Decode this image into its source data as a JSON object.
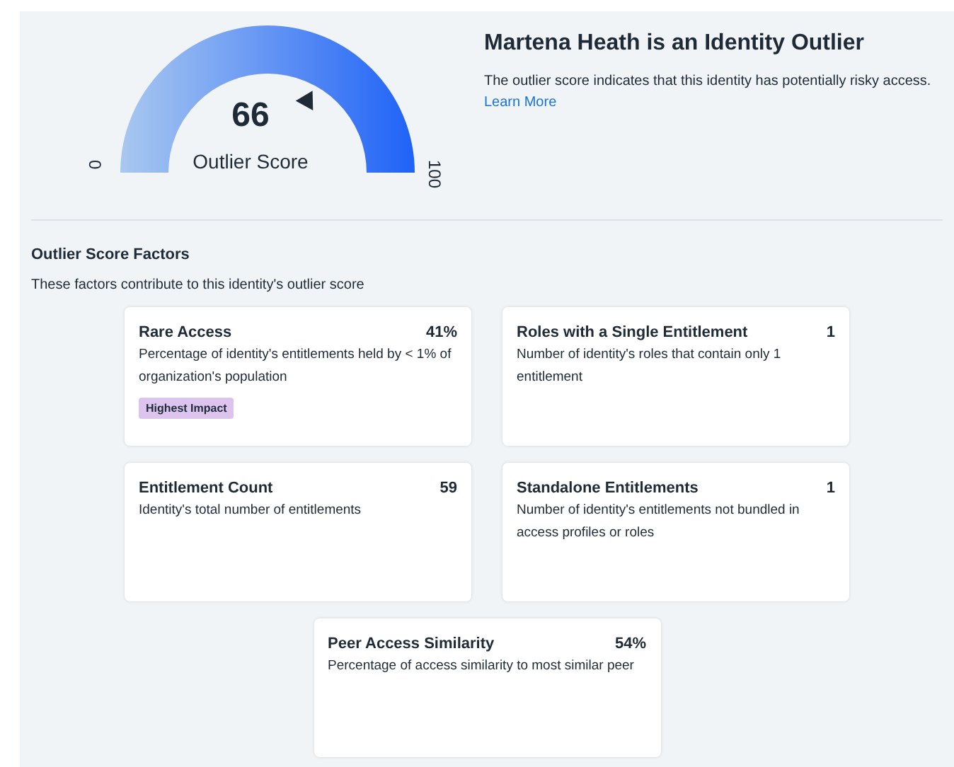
{
  "gauge": {
    "score": "66",
    "label": "Outlier Score",
    "min": "0",
    "max": "100",
    "level": 0.66
  },
  "summary": {
    "title": "Martena Heath is an Identity Outlier",
    "text": "The outlier score indicates that this identity has potentially risky access.",
    "link": "Learn More"
  },
  "factors": {
    "title": "Outlier Score Factors",
    "subtitle": "These factors contribute to this identity's outlier score",
    "cards": [
      {
        "name": "Rare Access",
        "value": "41%",
        "description": "Percentage of identity's entitlements held by < 1% of organization's population",
        "badge": "Highest Impact"
      },
      {
        "name": "Roles with a Single Entitlement",
        "value": "1",
        "description": "Number of identity's roles that contain only 1 entitlement"
      },
      {
        "name": "Entitlement Count",
        "value": "59",
        "description": "Identity's total number of entitlements"
      },
      {
        "name": "Standalone Entitlements",
        "value": "1",
        "description": "Number of identity's entitlements not bundled in access profiles or roles"
      },
      {
        "name": "Peer Access Similarity",
        "value": "54%",
        "description": "Percentage of access similarity to most similar peer"
      }
    ]
  }
}
